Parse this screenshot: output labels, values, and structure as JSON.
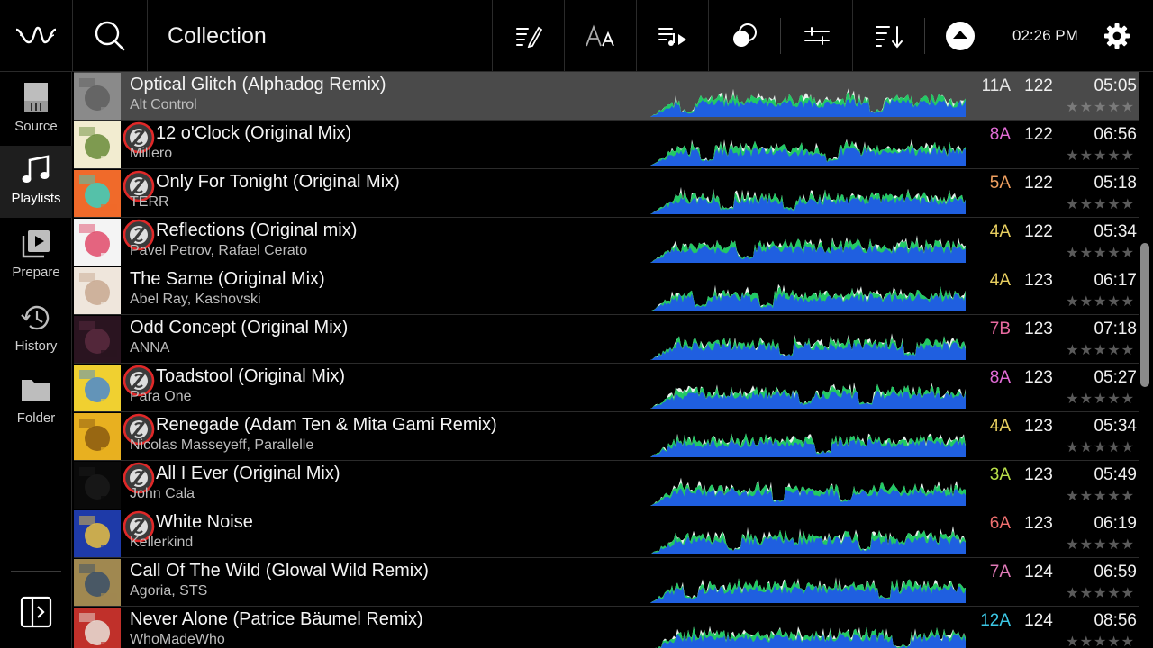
{
  "header": {
    "title": "Collection",
    "clock": "02:26 PM"
  },
  "sidebar": {
    "items": [
      {
        "label": "Source",
        "icon": "sd-card-icon"
      },
      {
        "label": "Playlists",
        "icon": "music-note-icon",
        "active": true
      },
      {
        "label": "Prepare",
        "icon": "prepare-queue-icon"
      },
      {
        "label": "History",
        "icon": "history-clock-icon"
      },
      {
        "label": "Folder",
        "icon": "folder-icon"
      }
    ]
  },
  "colors": {
    "key_11A": "#e6e6e6",
    "key_8A": "#e26cd6",
    "key_5A": "#f0a060",
    "key_4A": "#e8cf60",
    "key_7B": "#e86aa0",
    "key_3A": "#b9e04a",
    "key_6A": "#f07070",
    "key_7A": "#e07ab8",
    "key_12A": "#3cc8e6",
    "wave_blue": "#1f5fe0",
    "wave_green": "#22c964"
  },
  "tracks": [
    {
      "title": "Optical Glitch (Alphadog Remix)",
      "artist": "Alt Control",
      "key": "11A",
      "bpm": "122",
      "duration": "05:05",
      "rating": "★★★★★",
      "streaming": false,
      "selected": true,
      "art": [
        "#8a8a8a",
        "#5e5e5e"
      ]
    },
    {
      "title": "12 o'Clock (Original Mix)",
      "artist": "Millero",
      "key": "8A",
      "bpm": "122",
      "duration": "06:56",
      "rating": "★★★★★",
      "streaming": true,
      "art": [
        "#f2ecd0",
        "#6a8c3a"
      ]
    },
    {
      "title": "Only For Tonight (Original Mix)",
      "artist": "TERR",
      "key": "5A",
      "bpm": "122",
      "duration": "05:18",
      "rating": "★★★★★",
      "streaming": true,
      "art": [
        "#f06a2a",
        "#3ad0c0"
      ]
    },
    {
      "title": "Reflections (Original mix)",
      "artist": "Pavel Petrov, Rafael Cerato",
      "key": "4A",
      "bpm": "122",
      "duration": "05:34",
      "rating": "★★★★★",
      "streaming": true,
      "art": [
        "#f4f4f4",
        "#e04a6a"
      ]
    },
    {
      "title": "The Same (Original Mix)",
      "artist": "Abel Ray, Kashovski",
      "key": "4A",
      "bpm": "123",
      "duration": "06:17",
      "rating": "★★★★★",
      "streaming": false,
      "art": [
        "#efe6dc",
        "#c8a890"
      ]
    },
    {
      "title": "Odd Concept (Original Mix)",
      "artist": "ANNA",
      "key": "7B",
      "bpm": "123",
      "duration": "07:18",
      "rating": "★★★★★",
      "streaming": false,
      "art": [
        "#2a1420",
        "#5a2a40"
      ]
    },
    {
      "title": "Toadstool (Original Mix)",
      "artist": "Para One",
      "key": "8A",
      "bpm": "123",
      "duration": "05:27",
      "rating": "★★★★★",
      "streaming": true,
      "art": [
        "#f0d030",
        "#4a8ad0"
      ]
    },
    {
      "title": "Renegade (Adam Ten & Mita Gami Remix)",
      "artist": "Nicolas Masseyeff, Parallelle",
      "key": "4A",
      "bpm": "123",
      "duration": "05:34",
      "rating": "★★★★★",
      "streaming": true,
      "art": [
        "#e8b020",
        "#8a5a10"
      ]
    },
    {
      "title": "All I Ever (Original Mix)",
      "artist": "John Cala",
      "key": "3A",
      "bpm": "123",
      "duration": "05:49",
      "rating": "★★★★★",
      "streaming": true,
      "art": [
        "#0a0a0a",
        "#1a1a1a"
      ]
    },
    {
      "title": "White Noise",
      "artist": "Kellerkind",
      "key": "6A",
      "bpm": "123",
      "duration": "06:19",
      "rating": "★★★★★",
      "streaming": true,
      "art": [
        "#1e3aa8",
        "#e8c040"
      ]
    },
    {
      "title": "Call Of The Wild (Glowal Wild Remix)",
      "artist": "Agoria, STS",
      "key": "7A",
      "bpm": "124",
      "duration": "06:59",
      "rating": "★★★★★",
      "streaming": false,
      "art": [
        "#a08850",
        "#3a5068"
      ]
    },
    {
      "title": "Never Alone (Patrice Bäumel Remix)",
      "artist": "WhoMadeWho",
      "key": "12A",
      "bpm": "124",
      "duration": "08:56",
      "rating": "★★★★★",
      "streaming": false,
      "art": [
        "#c0302a",
        "#e8e0d8"
      ]
    }
  ]
}
